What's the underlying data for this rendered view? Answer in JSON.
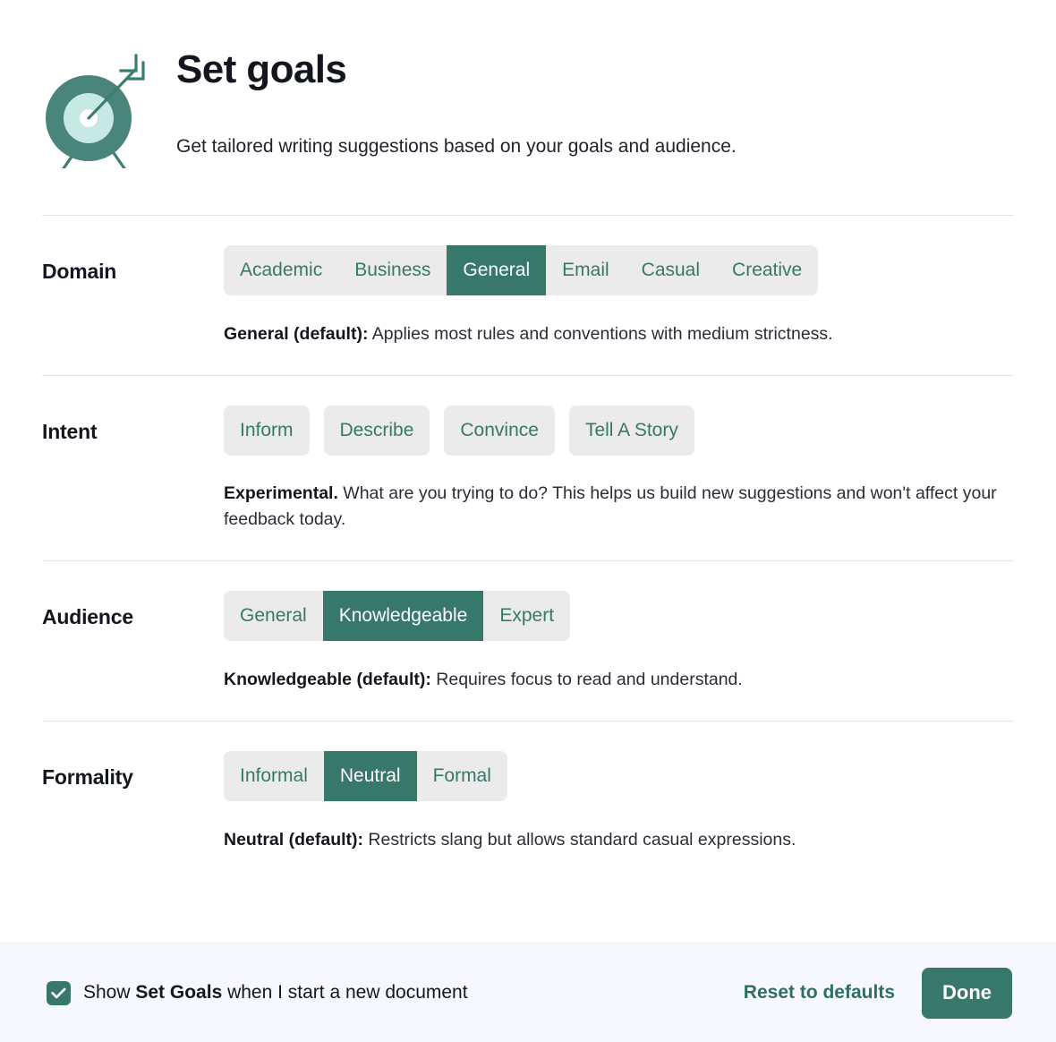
{
  "header": {
    "icon": "target-with-arrow-icon",
    "title": "Set goals",
    "subtitle": "Get tailored writing suggestions based on your goals and audience."
  },
  "colors": {
    "accent_green": "#37786a",
    "option_text_green": "#38786a",
    "option_bg_gray": "#ebebeb",
    "footer_bg": "#f7f8fd",
    "divider": "#e4e4e7",
    "text_dark": "#15171f"
  },
  "sections": [
    {
      "key": "domain",
      "label": "Domain",
      "style": "segmented",
      "options": [
        {
          "label": "Academic",
          "selected": false
        },
        {
          "label": "Business",
          "selected": false
        },
        {
          "label": "General",
          "selected": true
        },
        {
          "label": "Email",
          "selected": false
        },
        {
          "label": "Casual",
          "selected": false
        },
        {
          "label": "Creative",
          "selected": false
        }
      ],
      "description_lead": "General (default):",
      "description_rest": " Applies most rules and conventions with medium strictness."
    },
    {
      "key": "intent",
      "label": "Intent",
      "style": "pills",
      "options": [
        {
          "label": "Inform",
          "selected": false
        },
        {
          "label": "Describe",
          "selected": false
        },
        {
          "label": "Convince",
          "selected": false
        },
        {
          "label": "Tell A Story",
          "selected": false
        }
      ],
      "description_lead": "Experimental.",
      "description_rest": " What are you trying to do? This helps us build new suggestions and won't affect your feedback today."
    },
    {
      "key": "audience",
      "label": "Audience",
      "style": "segmented",
      "options": [
        {
          "label": "General",
          "selected": false
        },
        {
          "label": "Knowledgeable",
          "selected": true
        },
        {
          "label": "Expert",
          "selected": false
        }
      ],
      "description_lead": "Knowledgeable (default):",
      "description_rest": " Requires focus to read and understand."
    },
    {
      "key": "formality",
      "label": "Formality",
      "style": "segmented",
      "options": [
        {
          "label": "Informal",
          "selected": false
        },
        {
          "label": "Neutral",
          "selected": true
        },
        {
          "label": "Formal",
          "selected": false
        }
      ],
      "description_lead": "Neutral (default):",
      "description_rest": " Restricts slang but allows standard casual expressions."
    }
  ],
  "footer": {
    "checkbox_checked": true,
    "checkbox_label_before": "Show ",
    "checkbox_label_bold": "Set Goals",
    "checkbox_label_after": " when I start a new document",
    "reset_label": "Reset to defaults",
    "done_label": "Done"
  }
}
